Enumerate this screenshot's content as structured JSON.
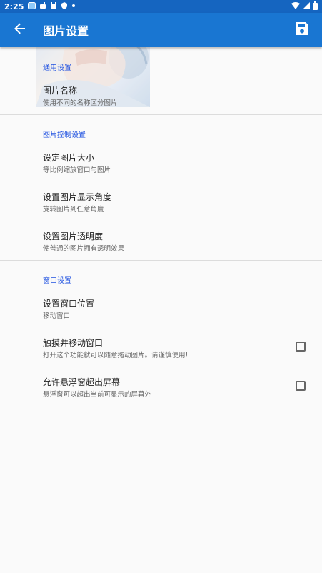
{
  "status_bar": {
    "time": "2:25",
    "icons": [
      "notification-icon",
      "android-icon",
      "android-icon",
      "shield-icon",
      "dot-icon"
    ],
    "right_icons": [
      "wifi-icon",
      "signal-icon",
      "battery-icon"
    ]
  },
  "app_bar": {
    "title": "图片设置",
    "back_icon": "arrow-back-icon",
    "save_icon": "save-icon"
  },
  "sections": [
    {
      "title": "通用设置",
      "items": [
        {
          "title": "图片名称",
          "summary": "使用不同的名称区分图片"
        }
      ]
    },
    {
      "title": "图片控制设置",
      "items": [
        {
          "title": "设定图片大小",
          "summary": "等比例缩放窗口与图片"
        },
        {
          "title": "设置图片显示角度",
          "summary": "旋转图片到任意角度"
        },
        {
          "title": "设置图片透明度",
          "summary": "使普通的图片拥有透明效果"
        }
      ]
    },
    {
      "title": "窗口设置",
      "items": [
        {
          "title": "设置窗口位置",
          "summary": "移动窗口"
        },
        {
          "title": "触摸并移动窗口",
          "summary": "打开这个功能就可以随意拖动图片。请谨慎使用!",
          "checked": false
        },
        {
          "title": "允许悬浮窗超出屏幕",
          "summary": "悬浮窗可以超出当前可显示的屏幕外",
          "checked": false
        }
      ]
    }
  ],
  "colors": {
    "status_bar": "#1565c0",
    "app_bar": "#1976d2",
    "section_title": "#1e50e0",
    "background": "#fafafa"
  }
}
